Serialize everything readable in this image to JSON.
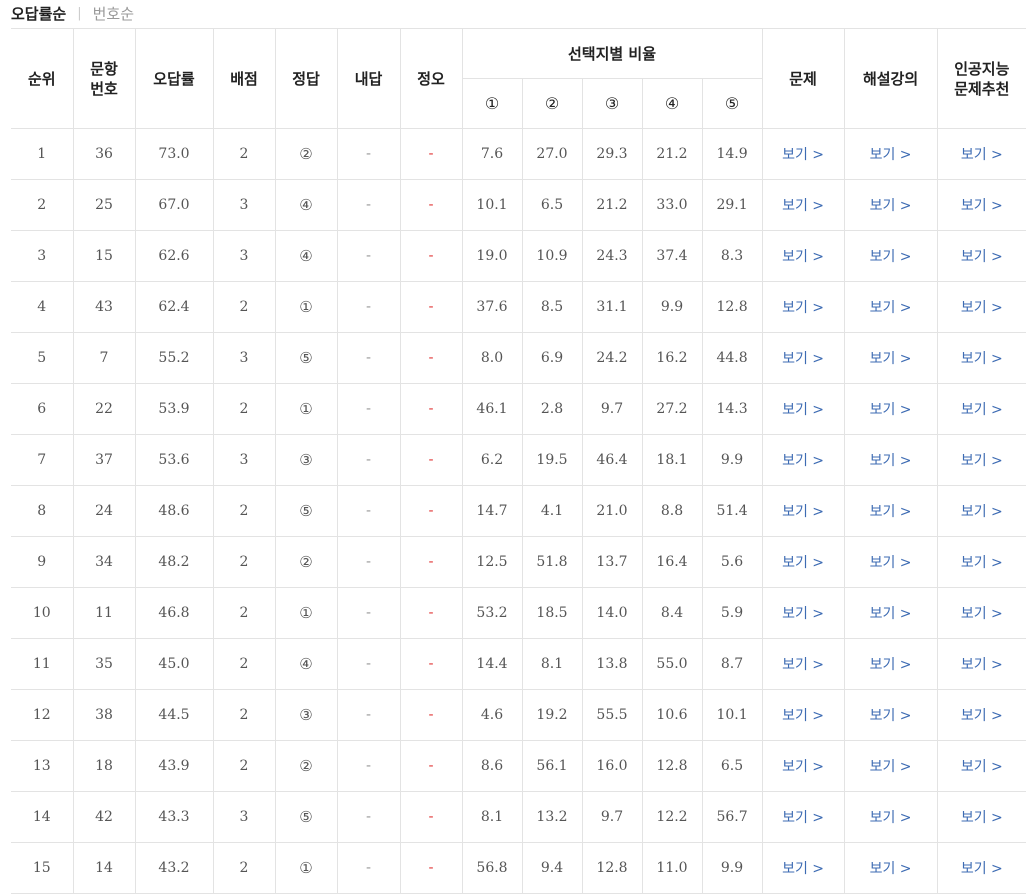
{
  "sort_tabs": {
    "active": "오답률순",
    "inactive": "번호순"
  },
  "headers": {
    "rank": "순위",
    "qnum": "문항\n번호",
    "wrong_rate": "오답률",
    "points": "배점",
    "answer": "정답",
    "my_answer": "내답",
    "correct": "정오",
    "choice_ratio": "선택지별 비율",
    "choices": [
      "①",
      "②",
      "③",
      "④",
      "⑤"
    ],
    "problem": "문제",
    "lecture": "해설강의",
    "ai": "인공지능\n문제추천"
  },
  "link_label": "보기 >",
  "dash": "-",
  "rows": [
    {
      "rank": "1",
      "qnum": "36",
      "rate": "73.0",
      "points": "2",
      "answer": "②",
      "my": "-",
      "ox": "-",
      "c": [
        "7.6",
        "27.0",
        "29.3",
        "21.2",
        "14.9"
      ]
    },
    {
      "rank": "2",
      "qnum": "25",
      "rate": "67.0",
      "points": "3",
      "answer": "④",
      "my": "-",
      "ox": "-",
      "c": [
        "10.1",
        "6.5",
        "21.2",
        "33.0",
        "29.1"
      ]
    },
    {
      "rank": "3",
      "qnum": "15",
      "rate": "62.6",
      "points": "3",
      "answer": "④",
      "my": "-",
      "ox": "-",
      "c": [
        "19.0",
        "10.9",
        "24.3",
        "37.4",
        "8.3"
      ]
    },
    {
      "rank": "4",
      "qnum": "43",
      "rate": "62.4",
      "points": "2",
      "answer": "①",
      "my": "-",
      "ox": "-",
      "c": [
        "37.6",
        "8.5",
        "31.1",
        "9.9",
        "12.8"
      ]
    },
    {
      "rank": "5",
      "qnum": "7",
      "rate": "55.2",
      "points": "3",
      "answer": "⑤",
      "my": "-",
      "ox": "-",
      "c": [
        "8.0",
        "6.9",
        "24.2",
        "16.2",
        "44.8"
      ]
    },
    {
      "rank": "6",
      "qnum": "22",
      "rate": "53.9",
      "points": "2",
      "answer": "①",
      "my": "-",
      "ox": "-",
      "c": [
        "46.1",
        "2.8",
        "9.7",
        "27.2",
        "14.3"
      ]
    },
    {
      "rank": "7",
      "qnum": "37",
      "rate": "53.6",
      "points": "3",
      "answer": "③",
      "my": "-",
      "ox": "-",
      "c": [
        "6.2",
        "19.5",
        "46.4",
        "18.1",
        "9.9"
      ]
    },
    {
      "rank": "8",
      "qnum": "24",
      "rate": "48.6",
      "points": "2",
      "answer": "⑤",
      "my": "-",
      "ox": "-",
      "c": [
        "14.7",
        "4.1",
        "21.0",
        "8.8",
        "51.4"
      ]
    },
    {
      "rank": "9",
      "qnum": "34",
      "rate": "48.2",
      "points": "2",
      "answer": "②",
      "my": "-",
      "ox": "-",
      "c": [
        "12.5",
        "51.8",
        "13.7",
        "16.4",
        "5.6"
      ]
    },
    {
      "rank": "10",
      "qnum": "11",
      "rate": "46.8",
      "points": "2",
      "answer": "①",
      "my": "-",
      "ox": "-",
      "c": [
        "53.2",
        "18.5",
        "14.0",
        "8.4",
        "5.9"
      ]
    },
    {
      "rank": "11",
      "qnum": "35",
      "rate": "45.0",
      "points": "2",
      "answer": "④",
      "my": "-",
      "ox": "-",
      "c": [
        "14.4",
        "8.1",
        "13.8",
        "55.0",
        "8.7"
      ]
    },
    {
      "rank": "12",
      "qnum": "38",
      "rate": "44.5",
      "points": "2",
      "answer": "③",
      "my": "-",
      "ox": "-",
      "c": [
        "4.6",
        "19.2",
        "55.5",
        "10.6",
        "10.1"
      ]
    },
    {
      "rank": "13",
      "qnum": "18",
      "rate": "43.9",
      "points": "2",
      "answer": "②",
      "my": "-",
      "ox": "-",
      "c": [
        "8.6",
        "56.1",
        "16.0",
        "12.8",
        "6.5"
      ]
    },
    {
      "rank": "14",
      "qnum": "42",
      "rate": "43.3",
      "points": "3",
      "answer": "⑤",
      "my": "-",
      "ox": "-",
      "c": [
        "8.1",
        "13.2",
        "9.7",
        "12.2",
        "56.7"
      ]
    },
    {
      "rank": "15",
      "qnum": "14",
      "rate": "43.2",
      "points": "2",
      "answer": "①",
      "my": "-",
      "ox": "-",
      "c": [
        "56.8",
        "9.4",
        "12.8",
        "11.0",
        "9.9"
      ]
    }
  ],
  "colors": {
    "link": "#3d6bb3",
    "red_dash": "#e23a3a",
    "header_border_top": "#333333",
    "grid": "#e3e3e3"
  }
}
